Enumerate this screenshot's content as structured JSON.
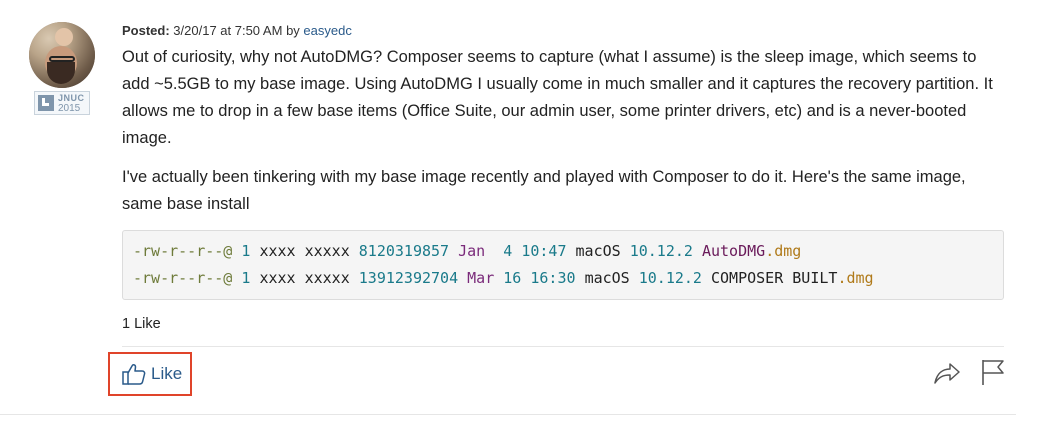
{
  "post": {
    "posted_label": "Posted:",
    "posted_datetime": "3/20/17 at 7:50 AM",
    "by_label": "by",
    "author": "easyedc",
    "badge_line1": "JNUC",
    "badge_line2": "2015",
    "paragraph1": "Out of curiosity, why not AutoDMG? Composer seems to capture (what I assume) is the sleep image, which seems to add ~5.5GB to my base image. Using AutoDMG I usually come in much smaller and it captures the recovery partition. It allows me to drop in a few base items (Office Suite, our admin user, some printer drivers, etc) and is a never-booted image.",
    "paragraph2": "I've actually been tinkering with my base image recently and played with Composer to do it. Here's the same image, same base install"
  },
  "code_lines": [
    {
      "perm": "-rw-r--r--@",
      "links": "1",
      "owner": "xxxx",
      "group": "xxxxx",
      "size": "8120319857",
      "month": "Jan",
      "day": " 4",
      "time": "10:47",
      "name_a": "macOS",
      "version": "10.12.2",
      "name_b": "AutoDMG",
      "ext": ".dmg"
    },
    {
      "perm": "-rw-r--r--@",
      "links": "1",
      "owner": "xxxx",
      "group": "xxxxx",
      "size": "13912392704",
      "month": "Mar",
      "day": "16",
      "time": "16:30",
      "name_a": "macOS",
      "version": "10.12.2",
      "name_b": "COMPOSER BUILT",
      "ext": ".dmg"
    }
  ],
  "footer": {
    "likes_count": "1 Like",
    "like_button_label": "Like"
  },
  "colors": {
    "link": "#2a5a8a",
    "highlight_border": "#e0442a"
  },
  "icons": [
    "thumbs-up-icon",
    "share-icon",
    "flag-icon"
  ]
}
